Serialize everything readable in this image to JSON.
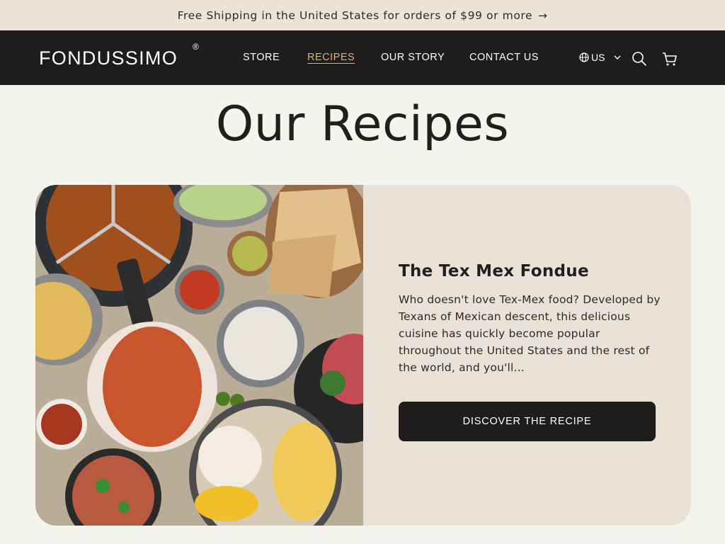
{
  "announcement": {
    "text": "Free Shipping in the United States for orders of $99 or more",
    "arrow": "→"
  },
  "header": {
    "logo": "FONDUSSIMO",
    "logo_mark": "®",
    "menu": [
      {
        "label": "STORE",
        "active": false
      },
      {
        "label": "RECIPES",
        "active": true
      },
      {
        "label": "OUR STORY",
        "active": false
      },
      {
        "label": "CONTACT US",
        "active": false
      }
    ],
    "region": "US",
    "icons": [
      "globe-icon",
      "chevron-down-icon",
      "search-icon",
      "cart-icon"
    ]
  },
  "main": {
    "title": "Our Recipes",
    "card": {
      "title": "The Tex Mex Fondue",
      "description": "Who doesn't love Tex-Mex food? Developed by Texans of Mexican descent, this delicious cuisine has quickly become popular throughout the United States and the rest of the world, and you'll...",
      "button": "DISCOVER THE RECIPE"
    }
  },
  "colors": {
    "accent": "#d9b27c",
    "nav_bg": "#1e1d1b",
    "announce_bg": "#ece4d9",
    "page_bg": "#f6f4ef",
    "card_bg": "#ebe2d7"
  }
}
